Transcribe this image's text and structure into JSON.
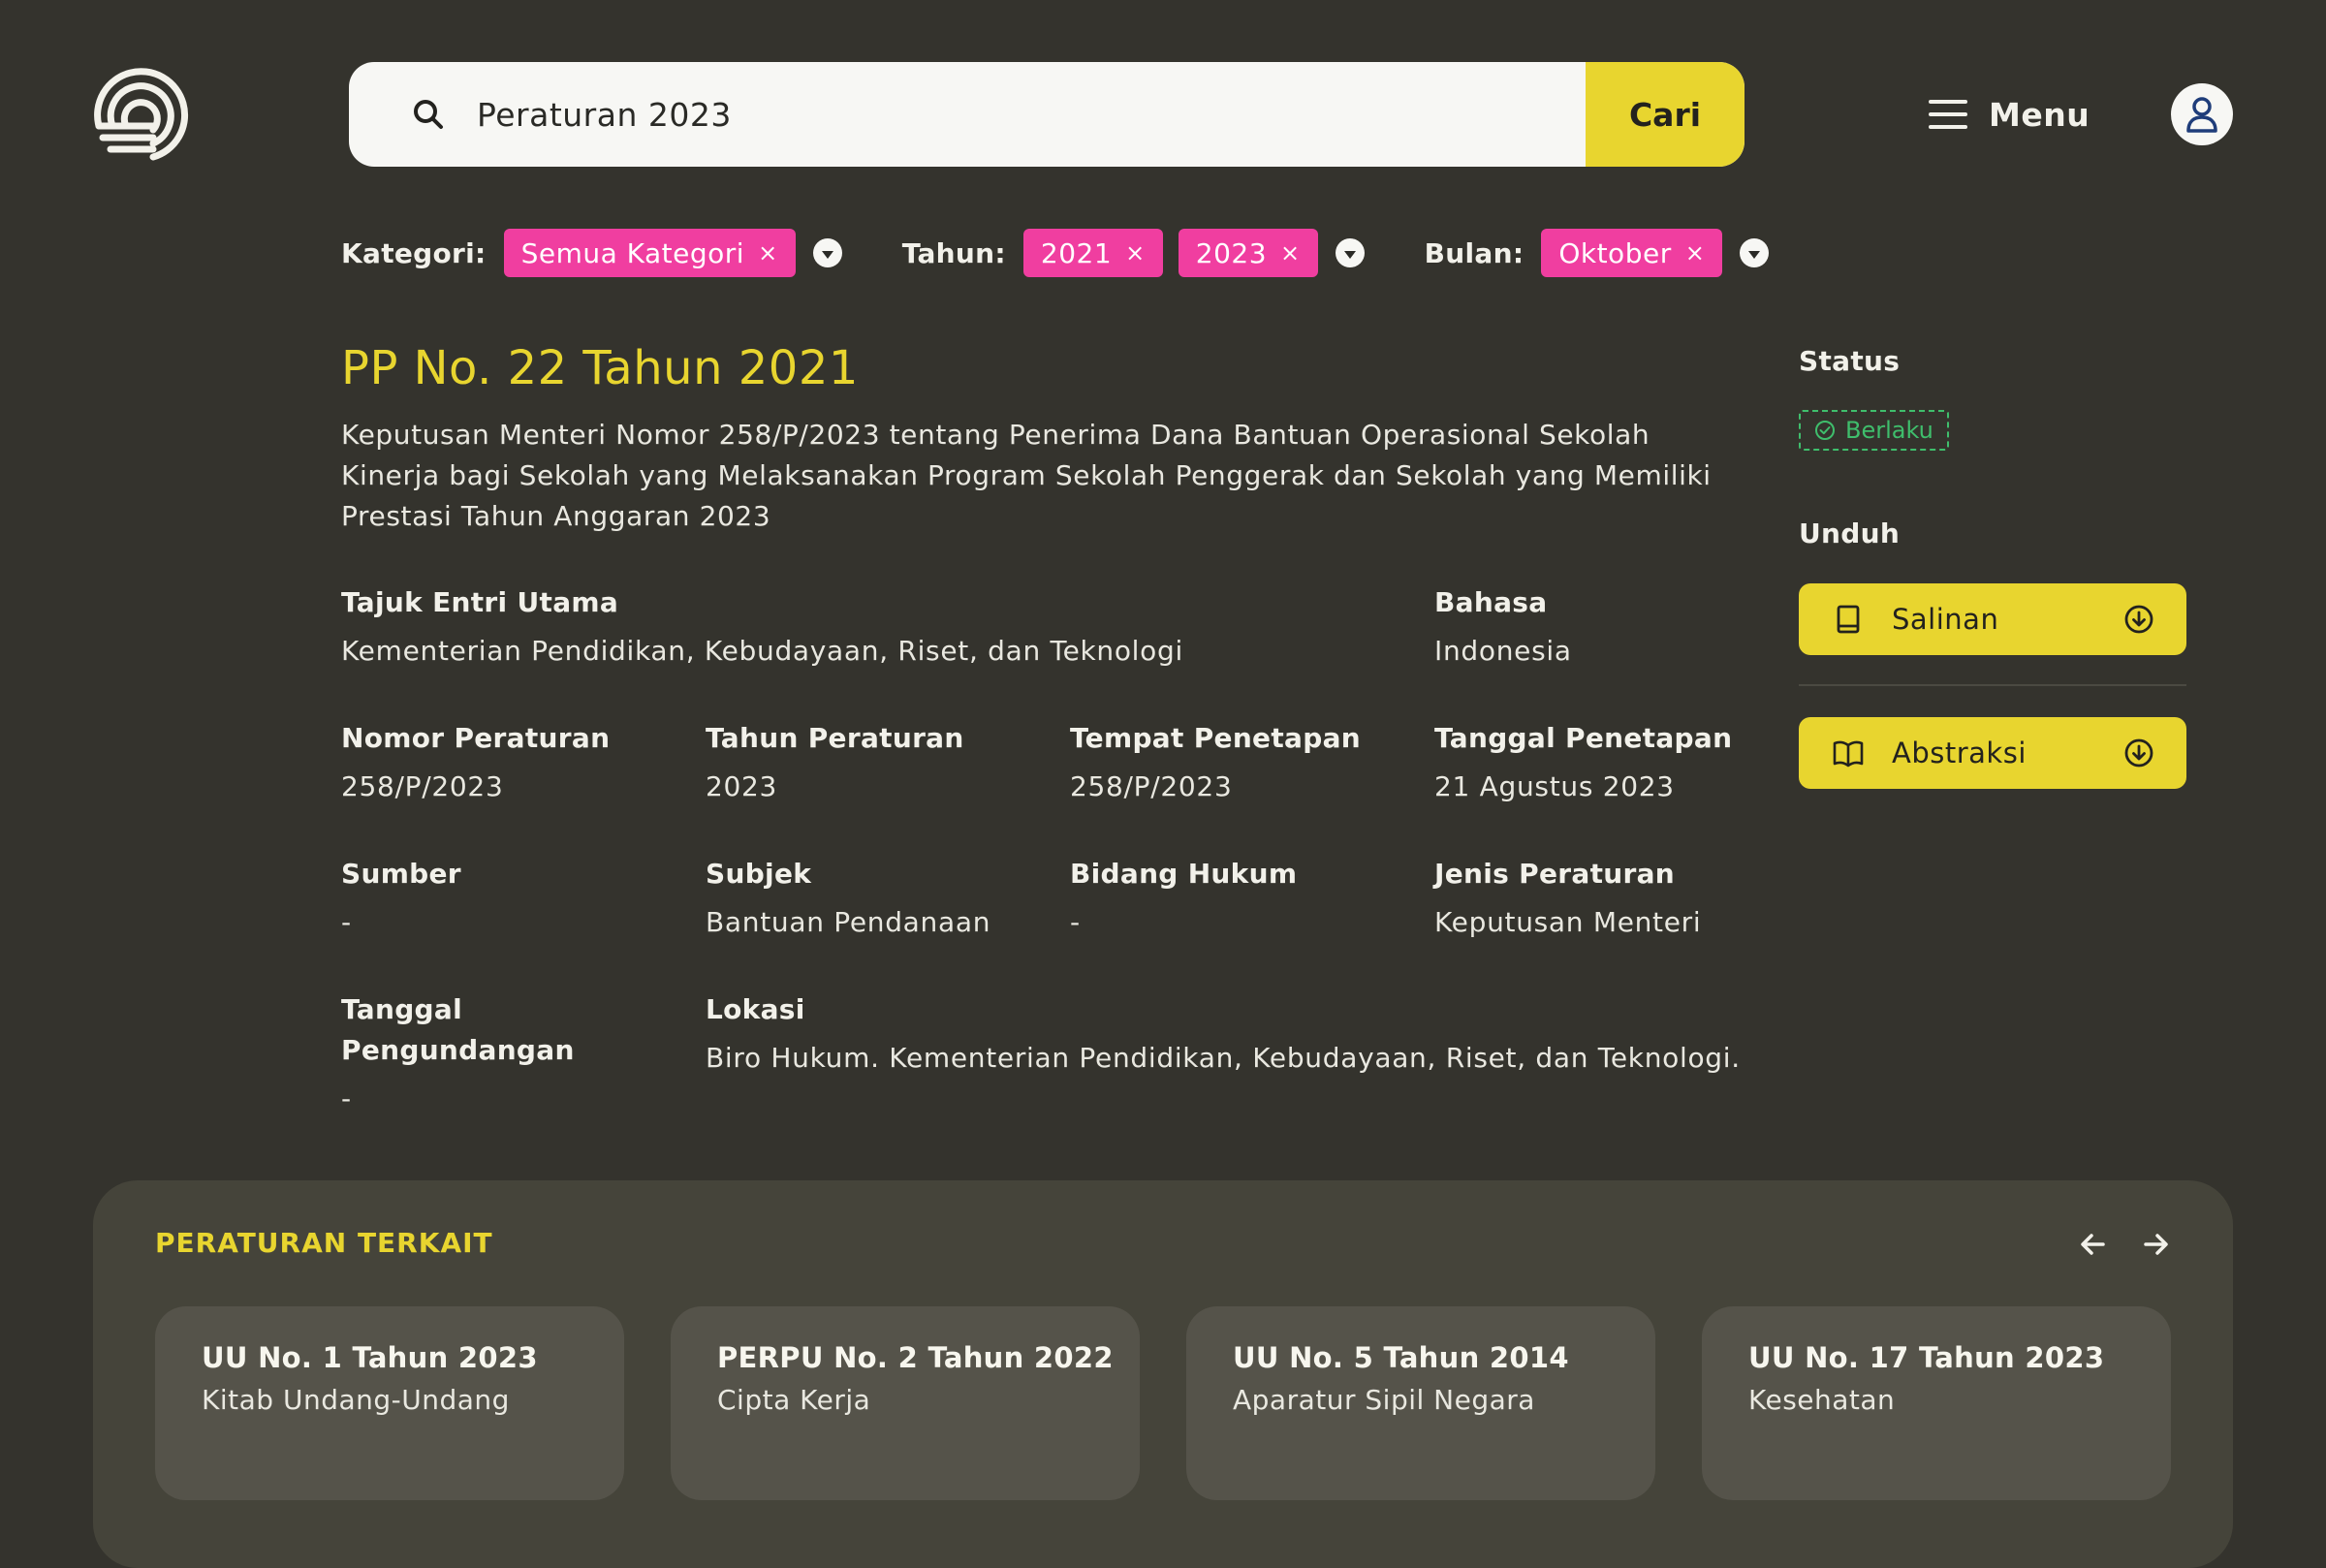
{
  "header": {
    "search_value": "Peraturan 2023",
    "search_button": "Cari",
    "menu_label": "Menu"
  },
  "filters": {
    "category_label": "Kategori:",
    "category_chips": [
      "Semua Kategori"
    ],
    "year_label": "Tahun:",
    "year_chips": [
      "2021",
      "2023"
    ],
    "month_label": "Bulan:",
    "month_chips": [
      "Oktober"
    ],
    "remove_symbol": "×"
  },
  "document": {
    "title": "PP No. 22 Tahun 2021",
    "description": "Keputusan Menteri Nomor 258/P/2023 tentang Penerima Dana Bantuan Operasional Sekolah Kinerja bagi Sekolah yang Melaksanakan Program Sekolah Penggerak dan Sekolah yang Memiliki Prestasi Tahun Anggaran 2023",
    "fields": {
      "tajuk_label": "Tajuk Entri Utama",
      "tajuk_value": "Kementerian Pendidikan, Kebudayaan, Riset, dan Teknologi",
      "bahasa_label": "Bahasa",
      "bahasa_value": "Indonesia",
      "nomor_label": "Nomor Peraturan",
      "nomor_value": "258/P/2023",
      "tahun_label": "Tahun Peraturan",
      "tahun_value": "2023",
      "tempat_label": "Tempat Penetapan",
      "tempat_value": "258/P/2023",
      "tanggal_label": "Tanggal Penetapan",
      "tanggal_value": "21 Agustus 2023",
      "sumber_label": "Sumber",
      "sumber_value": "-",
      "subjek_label": "Subjek",
      "subjek_value": "Bantuan Pendanaan",
      "bidang_label": "Bidang Hukum",
      "bidang_value": "-",
      "jenis_label": "Jenis Peraturan",
      "jenis_value": "Keputusan Menteri",
      "pengundangan_label_1": "Tanggal",
      "pengundangan_label_2": "Pengundangan",
      "pengundangan_value": "-",
      "lokasi_label": "Lokasi",
      "lokasi_value": "Biro Hukum. Kementerian Pendidikan, Kebudayaan, Riset, dan Teknologi."
    }
  },
  "sidebar": {
    "status_heading": "Status",
    "status_value": "Berlaku",
    "download_heading": "Unduh",
    "downloads": [
      {
        "label": "Salinan",
        "icon": "book-icon"
      },
      {
        "label": "Abstraksi",
        "icon": "open-book-icon"
      }
    ]
  },
  "related": {
    "heading": "PERATURAN TERKAIT",
    "cards": [
      {
        "title": "UU No. 1 Tahun 2023",
        "subtitle": "Kitab Undang-Undang"
      },
      {
        "title": "PERPU No. 2 Tahun 2022",
        "subtitle": "Cipta Kerja"
      },
      {
        "title": "UU No. 5 Tahun 2014",
        "subtitle": "Aparatur Sipil Negara"
      },
      {
        "title": "UU No. 17 Tahun 2023",
        "subtitle": "Kesehatan"
      }
    ]
  },
  "colors": {
    "background": "#34332d",
    "accent_yellow": "#e8d52f",
    "chip_pink": "#f03ea0",
    "status_green": "#3fbe6c",
    "panel": "#45443a",
    "card": "#55534a"
  }
}
